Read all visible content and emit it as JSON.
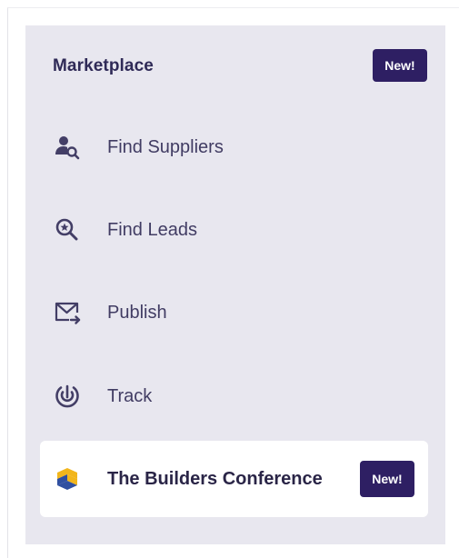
{
  "sidebar": {
    "section_title": "Marketplace",
    "section_badge": "New!",
    "items": [
      {
        "label": "Find Suppliers",
        "icon": "find-suppliers-icon"
      },
      {
        "label": "Find Leads",
        "icon": "find-leads-icon"
      },
      {
        "label": "Publish",
        "icon": "publish-icon"
      },
      {
        "label": "Track",
        "icon": "track-icon"
      }
    ],
    "featured": {
      "label": "The Builders Conference",
      "badge": "New!",
      "icon": "builders-conference-logo-icon"
    }
  },
  "colors": {
    "panel_bg": "#e8e7ef",
    "badge_bg": "#2e1f63",
    "icon": "#433e66",
    "logo_yellow": "#f2b61c",
    "logo_blue": "#2f4fa0"
  }
}
